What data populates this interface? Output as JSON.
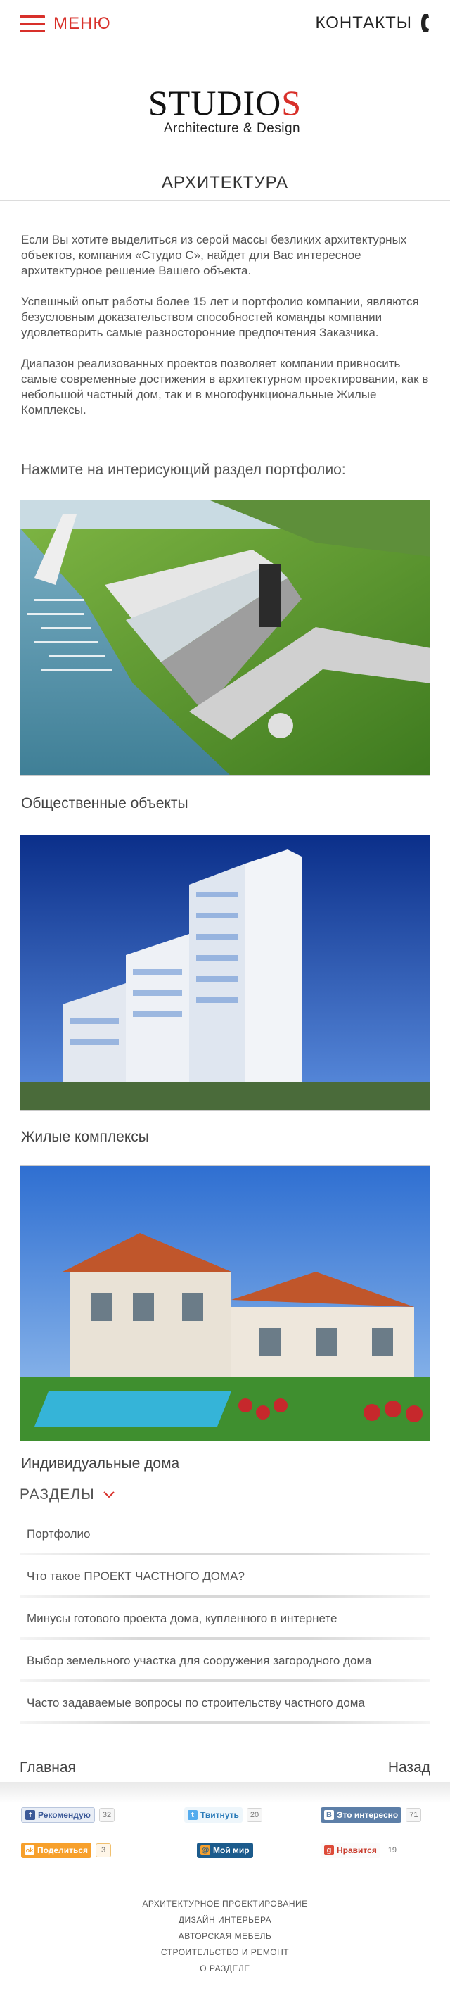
{
  "header": {
    "menu_label": "МЕНЮ",
    "contacts_label": "КОНТАКТЫ"
  },
  "logo": {
    "main_prefix": "STUDIO",
    "main_suffix": "S",
    "subtitle": "Architecture & Design"
  },
  "page": {
    "title": "АРХИТЕКТУРА",
    "intro": [
      "Если Вы хотите выделиться из серой массы безликих архитектурных объектов, компания «Студио С», найдет для Вас интересное архитектурное решение Вашего объекта.",
      "Успешный опыт работы более 15 лет и портфолио компании, являются безусловным доказательством способностей команды компании удовлетворить самые разносторонние предпочтения Заказчика.",
      "Диапазон реализованных проектов позволяет компании привносить самые современные достижения в архитектурном проектировании, как в небольшой частный дом, так и в многофункциональные Жилые Комплексы."
    ],
    "prompt": "Нажмите на интерисующий раздел портфолио:"
  },
  "portfolio": [
    {
      "label": "Общественные объекты",
      "image": "marina-complex-render"
    },
    {
      "label": "Жилые комплексы",
      "image": "residential-tower-render"
    },
    {
      "label": "Индивидуальные дома",
      "image": "private-villa-render"
    }
  ],
  "sections": {
    "label": "РАЗДЕЛЫ",
    "items": [
      "Портфолио",
      "Что такое ПРОЕКТ ЧАСТНОГО ДОМА?",
      "Минусы готового проекта дома, купленного в интернете",
      "Выбор земельного участка для сооружения загородного дома",
      "Часто задаваемые вопросы по строительству частного дома"
    ]
  },
  "nav": {
    "home": "Главная",
    "back": "Назад"
  },
  "share": [
    {
      "label": "Рекомендую",
      "count": "32",
      "icon": "facebook-icon",
      "glyph": "f"
    },
    {
      "label": "Твитнуть",
      "count": "20",
      "icon": "twitter-icon",
      "glyph": "t"
    },
    {
      "label": "Это интересно",
      "count": "71",
      "icon": "vk-icon",
      "glyph": "B"
    },
    {
      "label": "Поделиться",
      "count": "3",
      "icon": "odnoklassniki-icon",
      "glyph": "ok"
    },
    {
      "label": "Мой мир",
      "count": "",
      "icon": "moymir-icon",
      "glyph": "@"
    },
    {
      "label": "Нравится",
      "count": "19",
      "icon": "google-plus-icon",
      "glyph": "g"
    }
  ],
  "footer_links": [
    "АРХИТЕКТУРНОЕ ПРОЕКТИРОВАНИЕ",
    "ДИЗАЙН ИНТЕРЬЕРА",
    "АВТОРСКАЯ МЕБЕЛЬ",
    "СТРОИТЕЛЬСТВО И РЕМОНТ",
    "О РАЗДЕЛЕ"
  ],
  "colors": {
    "accent": "#d8302a",
    "text": "#555555"
  }
}
